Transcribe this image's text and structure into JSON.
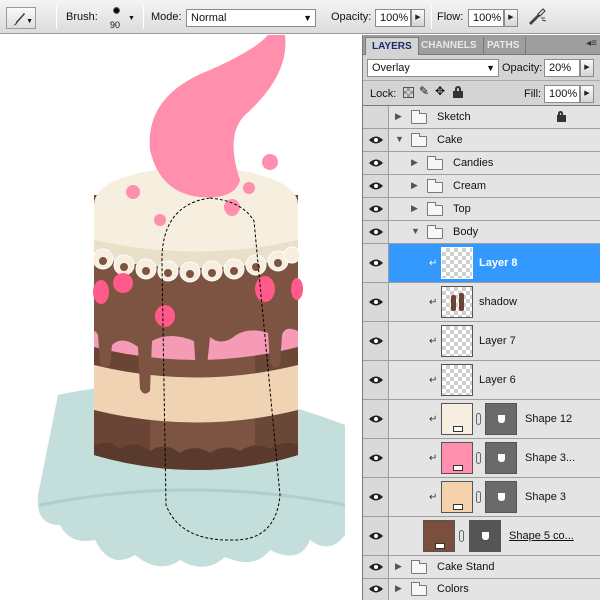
{
  "options_bar": {
    "brush_label": "Brush:",
    "brush_size": "90",
    "mode_label": "Mode:",
    "mode_value": "Normal",
    "opacity_label": "Opacity:",
    "opacity_value": "100%",
    "flow_label": "Flow:",
    "flow_value": "100%"
  },
  "panel": {
    "tabs": [
      "LAYERS",
      "CHANNELS",
      "PATHS"
    ],
    "blend_mode": "Overlay",
    "opacity_label": "Opacity:",
    "opacity_value": "20%",
    "lock_label": "Lock:",
    "fill_label": "Fill:",
    "fill_value": "100%"
  },
  "layers": [
    {
      "name": "Sketch",
      "kind": "group",
      "visible": false,
      "locked": true
    },
    {
      "name": "Cake",
      "kind": "group",
      "visible": true,
      "expanded": true
    },
    {
      "name": "Candies",
      "kind": "group",
      "visible": true
    },
    {
      "name": "Cream",
      "kind": "group",
      "visible": true
    },
    {
      "name": "Top",
      "kind": "group",
      "visible": true
    },
    {
      "name": "Body",
      "kind": "group",
      "visible": true,
      "expanded": true
    },
    {
      "name": "Layer 8",
      "kind": "pixel",
      "visible": true,
      "selected": true
    },
    {
      "name": "shadow",
      "kind": "pixel",
      "visible": true
    },
    {
      "name": "Layer 7",
      "kind": "pixel",
      "visible": true
    },
    {
      "name": "Layer 6",
      "kind": "pixel",
      "visible": true
    },
    {
      "name": "Shape 12",
      "kind": "shape",
      "visible": true,
      "color": "#f6eede"
    },
    {
      "name": "Shape 3...",
      "kind": "shape",
      "visible": true,
      "color": "#ff8fac"
    },
    {
      "name": "Shape 3",
      "kind": "shape",
      "visible": true,
      "color": "#f4d3ac"
    },
    {
      "name": "Shape 5 co...",
      "kind": "shape",
      "visible": true,
      "color": "#7a4f3c"
    },
    {
      "name": "Cake Stand",
      "kind": "group",
      "visible": true
    },
    {
      "name": "Colors",
      "kind": "group",
      "visible": true
    }
  ],
  "colors": {
    "selection": "#3399ff",
    "cream": "#f6eede",
    "chocolate": "#7d5441",
    "pink": "#ff8fac",
    "candy": "#ff5a8a",
    "beige": "#efd3b2",
    "stand": "#c4dedb"
  }
}
